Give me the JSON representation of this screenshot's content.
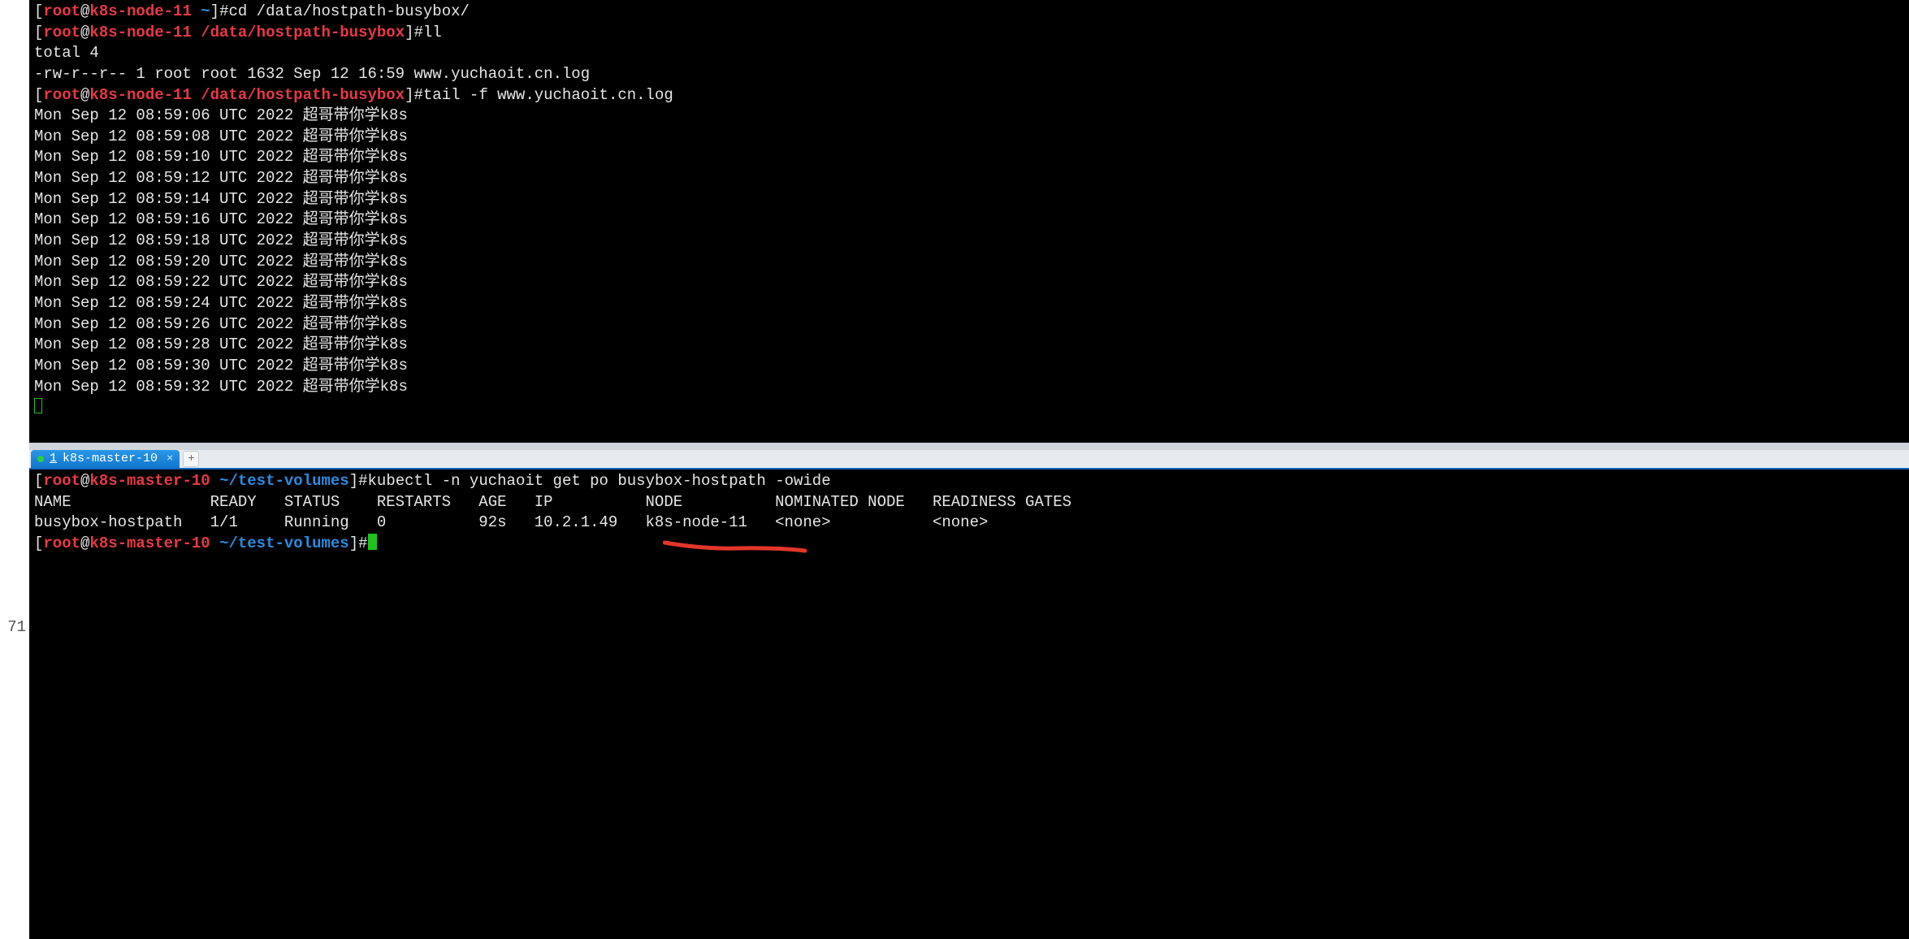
{
  "left_gutter_line": "71",
  "top_pane": {
    "prompts": [
      {
        "user": "root",
        "host": "k8s-node-11",
        "cwd": "~",
        "cmd": "cd /data/hostpath-busybox/"
      },
      {
        "user": "root",
        "host": "k8s-node-11",
        "cwd": "/data/hostpath-busybox",
        "cmd": "ll"
      }
    ],
    "ll_output": [
      "total 4",
      "-rw-r--r-- 1 root root 1632 Sep 12 16:59 www.yuchaoit.cn.log"
    ],
    "tail_prompt": {
      "user": "root",
      "host": "k8s-node-11",
      "cwd": "/data/hostpath-busybox",
      "cmd": "tail -f www.yuchaoit.cn.log"
    },
    "tail_lines": [
      "Mon Sep 12 08:59:06 UTC 2022 超哥带你学k8s",
      "Mon Sep 12 08:59:08 UTC 2022 超哥带你学k8s",
      "Mon Sep 12 08:59:10 UTC 2022 超哥带你学k8s",
      "Mon Sep 12 08:59:12 UTC 2022 超哥带你学k8s",
      "Mon Sep 12 08:59:14 UTC 2022 超哥带你学k8s",
      "Mon Sep 12 08:59:16 UTC 2022 超哥带你学k8s",
      "Mon Sep 12 08:59:18 UTC 2022 超哥带你学k8s",
      "Mon Sep 12 08:59:20 UTC 2022 超哥带你学k8s",
      "Mon Sep 12 08:59:22 UTC 2022 超哥带你学k8s",
      "Mon Sep 12 08:59:24 UTC 2022 超哥带你学k8s",
      "Mon Sep 12 08:59:26 UTC 2022 超哥带你学k8s",
      "Mon Sep 12 08:59:28 UTC 2022 超哥带你学k8s",
      "Mon Sep 12 08:59:30 UTC 2022 超哥带你学k8s",
      "Mon Sep 12 08:59:32 UTC 2022 超哥带你学k8s"
    ]
  },
  "tab": {
    "num": "1",
    "title": "k8s-master-10",
    "close": "×"
  },
  "newtab_label": "+",
  "bottom_pane": {
    "prompts": [
      {
        "user": "root",
        "host": "k8s-master-10",
        "cwd": "~/test-volumes",
        "cmd": "kubectl -n yuchaoit get po busybox-hostpath -owide"
      }
    ],
    "table_header": "NAME               READY   STATUS    RESTARTS   AGE   IP          NODE          NOMINATED NODE   READINESS GATES",
    "table_row": "busybox-hostpath   1/1     Running   0          92s   10.2.1.49   k8s-node-11   <none>           <none>",
    "prompt_idle": {
      "user": "root",
      "host": "k8s-master-10",
      "cwd": "~/test-volumes",
      "cmd": ""
    }
  },
  "annotation_color": "#e3362a"
}
